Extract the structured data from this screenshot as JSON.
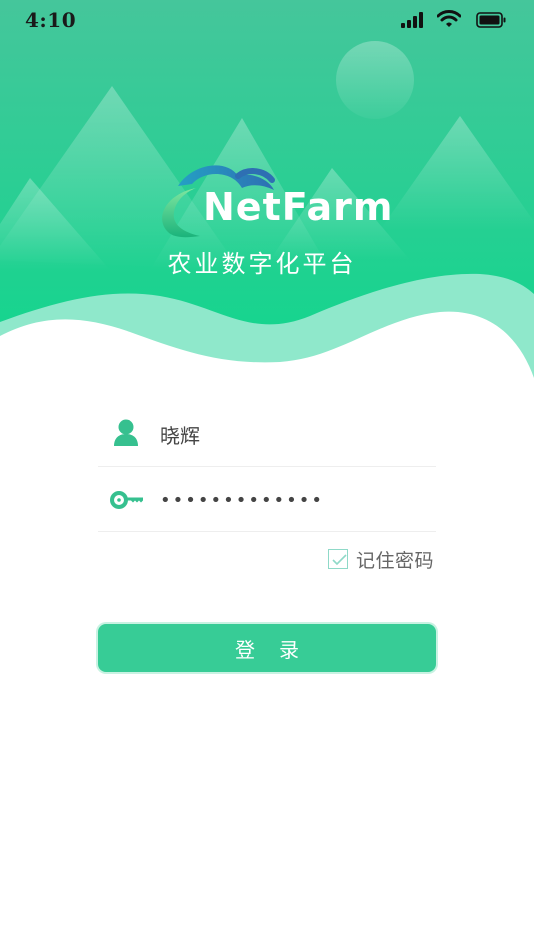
{
  "status_bar": {
    "time": "4:10",
    "icons": [
      "cellular-signal-icon",
      "wifi-icon",
      "battery-icon"
    ]
  },
  "brand": {
    "name": "NetFarm",
    "tagline": "农业数字化平台",
    "logo_icon": "cloud-logo-icon"
  },
  "form": {
    "username_icon": "user-icon",
    "username_value": "晓辉",
    "password_icon": "key-icon",
    "password_value": "•••••••••••••",
    "remember_label": "记住密码",
    "remember_checked": true,
    "login_label": "登录"
  },
  "colors": {
    "primary": "#37cc96",
    "hero_top": "#43c89a",
    "hero_bottom": "#10d68c",
    "wave_light": "#8fe8cb",
    "text_muted": "#666666"
  }
}
